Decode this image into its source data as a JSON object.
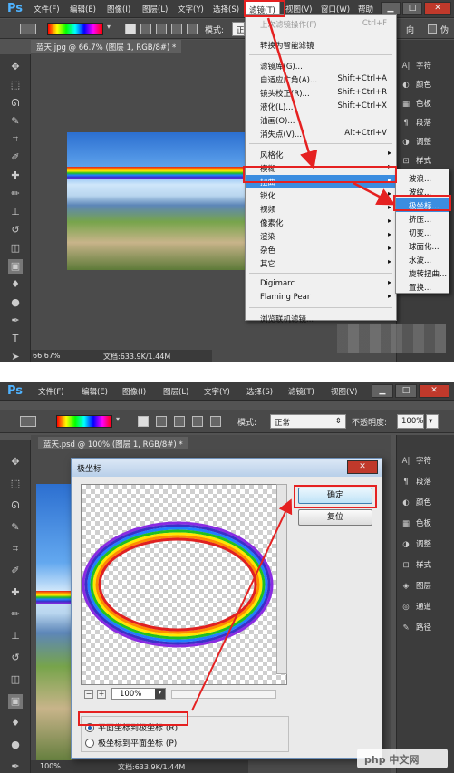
{
  "app": {
    "logo": "Ps"
  },
  "screenshot1": {
    "menus": [
      "文件(F)",
      "编辑(E)",
      "图像(I)",
      "图层(L)",
      "文字(Y)",
      "选择(S)",
      "滤镜(T)",
      "视图(V)",
      "窗口(W)",
      "帮助"
    ],
    "options": {
      "mode_label": "模式:",
      "mode_value": "正",
      "right1": "向",
      "right2": "伪"
    },
    "doc_tab": "蓝天.jpg @ 66.7% (图层 1, RGB/8#) *",
    "zoom": "66.67%",
    "doc_info": "文档:633.9K/1.44M",
    "panel": [
      {
        "icon": "A|",
        "label": "字符"
      },
      {
        "icon": "◐",
        "label": "颜色"
      },
      {
        "icon": "▦",
        "label": "色板"
      },
      {
        "icon": "¶",
        "label": "段落"
      },
      {
        "icon": "◑",
        "label": "调整"
      },
      {
        "icon": "⊡",
        "label": "样式"
      }
    ],
    "filter_menu": {
      "items": [
        {
          "label": "上次滤镜操作(F)",
          "shortcut": "Ctrl+F",
          "disabled": true
        },
        {
          "label": "转换为智能滤镜"
        },
        {
          "label": "滤镜库(G)..."
        },
        {
          "label": "自适应广角(A)...",
          "shortcut": "Shift+Ctrl+A"
        },
        {
          "label": "镜头校正(R)...",
          "shortcut": "Shift+Ctrl+R"
        },
        {
          "label": "液化(L)...",
          "shortcut": "Shift+Ctrl+X"
        },
        {
          "label": "油画(O)..."
        },
        {
          "label": "消失点(V)...",
          "shortcut": "Alt+Ctrl+V"
        },
        {
          "label": "风格化",
          "arrow": true
        },
        {
          "label": "模糊",
          "arrow": true
        },
        {
          "label": "扭曲",
          "arrow": true
        },
        {
          "label": "锐化",
          "arrow": true
        },
        {
          "label": "视频",
          "arrow": true
        },
        {
          "label": "像素化",
          "arrow": true
        },
        {
          "label": "渲染",
          "arrow": true
        },
        {
          "label": "杂色",
          "arrow": true
        },
        {
          "label": "其它",
          "arrow": true
        },
        {
          "label": "Digimarc",
          "arrow": true
        },
        {
          "label": "Flaming Pear",
          "arrow": true
        },
        {
          "label": "浏览联机滤镜..."
        }
      ]
    },
    "distort_submenu": [
      "波浪...",
      "波纹...",
      "极坐标...",
      "挤压...",
      "切变...",
      "球面化...",
      "水波...",
      "旋转扭曲...",
      "置换..."
    ]
  },
  "screenshot2": {
    "menus": [
      "文件(F)",
      "编辑(E)",
      "图像(I)",
      "图层(L)",
      "文字(Y)",
      "选择(S)",
      "滤镜(T)",
      "视图(V)"
    ],
    "options": {
      "mode_label": "模式:",
      "mode_value": "正常",
      "opacity_label": "不透明度:",
      "opacity_value": "100%"
    },
    "doc_tab": "蓝天.psd @ 100% (图层 1, RGB/8#) *",
    "zoom": "100%",
    "doc_info": "文档:633.9K/1.44M",
    "panel": [
      {
        "icon": "A|",
        "label": "字符"
      },
      {
        "icon": "¶",
        "label": "段落"
      },
      {
        "icon": "◐",
        "label": "颜色"
      },
      {
        "icon": "▦",
        "label": "色板"
      },
      {
        "icon": "◑",
        "label": "调整"
      },
      {
        "icon": "⊡",
        "label": "样式"
      },
      {
        "icon": "◈",
        "label": "图层"
      },
      {
        "icon": "◎",
        "label": "通道"
      },
      {
        "icon": "✎",
        "label": "路径"
      }
    ],
    "dialog": {
      "title": "极坐标",
      "ok": "确定",
      "reset": "复位",
      "zoom": "100%",
      "option1": "平面坐标到极坐标 (R)",
      "option2": "极坐标到平面坐标 (P)",
      "selected": 0
    }
  },
  "watermark": "php 中文网",
  "colors": {
    "accent_red": "#e52121",
    "highlight_blue": "#3b8de0",
    "ps_blue": "#4fb3ff"
  }
}
